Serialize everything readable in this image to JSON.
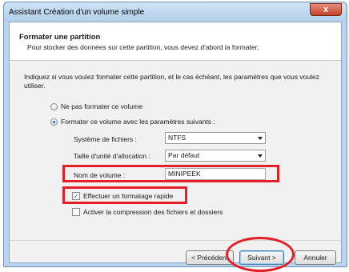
{
  "window": {
    "title": "Assistant Création d'un volume simple",
    "close_label": "x"
  },
  "header": {
    "title": "Formater une partition",
    "subtitle": "Pour stocker des données sur cette partition, vous devez d'abord la formater."
  },
  "intro": "Indiquez si vous voulez formater cette partition, et le cas échéant, les paramètres que vous voulez utiliser.",
  "options": {
    "no_format": {
      "label": "Ne pas formater ce volume",
      "selected": false
    },
    "format": {
      "label": "Formater ce volume avec les paramètres suivants :",
      "selected": true
    }
  },
  "fields": {
    "filesystem": {
      "label": "Système de fichiers :",
      "value": "NTFS"
    },
    "alloc_unit": {
      "label": "Taille d'unité d'allocation :",
      "value": "Par défaut"
    },
    "volume_name": {
      "label": "Nom de volume :",
      "value": "MINIPEEK"
    }
  },
  "checks": {
    "quick_format": {
      "label": "Effectuer un formatage rapide",
      "checked": true
    },
    "compression": {
      "label": "Activer la compression des fichiers et dossiers",
      "checked": false
    }
  },
  "buttons": {
    "back": "< Précédent",
    "next": "Suivant >",
    "cancel": "Annuler"
  },
  "annotation_color": "#e3202a"
}
